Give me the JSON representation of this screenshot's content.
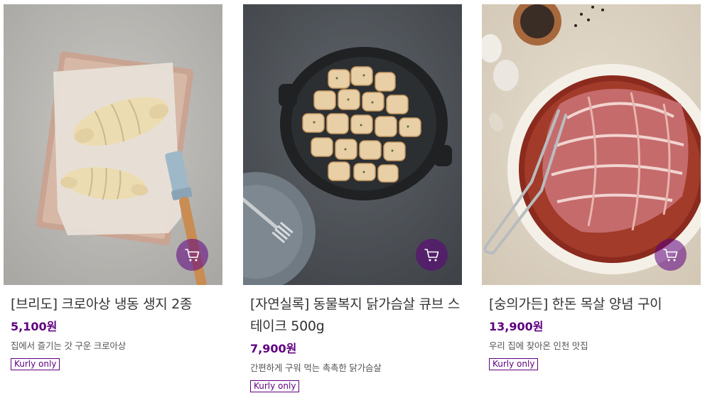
{
  "products": [
    {
      "name": "[브리도] 크로아상 냉동 생지 2종",
      "price": "5,100원",
      "description": "집에서 즐기는 갓 구운 크로아상",
      "badge": "Kurly only",
      "cart_icon": "cart-icon"
    },
    {
      "name": "[자연실록] 동물복지 닭가슴살 큐브 스테이크 500g",
      "price": "7,900원",
      "description": "간편하게 구워 먹는 촉촉한 닭가슴살",
      "badge": "Kurly only",
      "cart_icon": "cart-icon"
    },
    {
      "name": "[숭의가든] 한돈 목살 양념 구이",
      "price": "13,900원",
      "description": "우리 집에 찾아온 인천 맛집",
      "badge": "Kurly only",
      "cart_icon": "cart-icon"
    }
  ],
  "colors": {
    "accent": "#5f0080",
    "cart_button_bg": "rgba(95,0,128,0.55)"
  }
}
